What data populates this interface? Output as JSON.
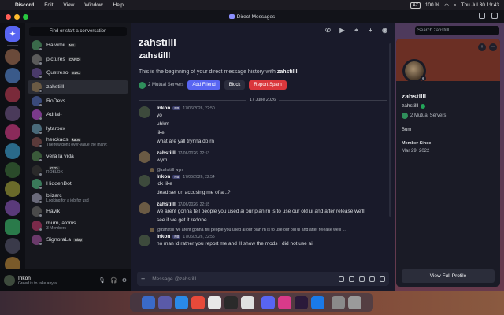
{
  "menubar": {
    "apple": "",
    "app": "Discord",
    "items": [
      "Edit",
      "View",
      "Window",
      "Help"
    ],
    "battery": "100 %",
    "clock": "Thu Jul 30 19:43",
    "input_source": "AZ"
  },
  "window": {
    "title": "Direct Messages"
  },
  "dm_list": {
    "find": "Find or start a conversation",
    "items": [
      {
        "name": "Halwmii",
        "tag": "NB",
        "sub": "",
        "color": "#3a6a4a"
      },
      {
        "name": "pictures",
        "tag": "CARD",
        "sub": "",
        "color": "#5a5a5a"
      },
      {
        "name": "Qustreso",
        "tag": "SDC",
        "sub": "",
        "color": "#4a3a6a"
      },
      {
        "name": "zahstilll",
        "tag": "",
        "sub": "",
        "color": "#6a5a44"
      },
      {
        "name": "RoDevs",
        "tag": "",
        "sub": "",
        "color": "#3a4a7a"
      },
      {
        "name": "Adrial-",
        "tag": "",
        "sub": "",
        "color": "#7a3a8a"
      },
      {
        "name": "lytarbox",
        "tag": "",
        "sub": "",
        "color": "#4a6a7a"
      },
      {
        "name": "herckaos",
        "tag": "kaos",
        "sub": "The few don't over-value the many.",
        "color": "#5a3a3a"
      },
      {
        "name": "vera la vida",
        "tag": "",
        "sub": "",
        "color": "#3a5a3a"
      },
      {
        "name": "",
        "tag": "GTD",
        "sub": "ROBLOX",
        "color": "#2a2a2a"
      },
      {
        "name": "HiddenBot",
        "tag": "",
        "sub": "",
        "color": "#3a7a5a"
      },
      {
        "name": "blizarc",
        "tag": "",
        "sub": "Looking for a job for usd",
        "color": "#6a6a7a"
      },
      {
        "name": "Havik",
        "tag": "",
        "sub": "",
        "color": "#4a4a4a"
      },
      {
        "name": "murn, atonis",
        "tag": "",
        "sub": "3 Members",
        "color": "#7a2a4a"
      },
      {
        "name": "SignoraLa",
        "tag": "Blap",
        "sub": "",
        "color": "#6a3a6a"
      }
    ]
  },
  "user_panel": {
    "name": "Inkon",
    "status": "Greed is to take any a..."
  },
  "chat": {
    "header_name": "zahstilll",
    "search_placeholder": "Search zahstilll",
    "intro_name": "zahstilll",
    "intro_name2": "zahstilll",
    "intro_prefix": "This is the beginning of your direct message history with ",
    "intro_user": "zahstilll",
    "intro_suffix": ".",
    "mutual_servers": "2 Mutual Servers",
    "add_friend": "Add Friend",
    "block": "Block",
    "report_spam": "Report Spam",
    "date_divider": "17 June 2026",
    "composer_placeholder": "Message @zahstilll",
    "messages": [
      {
        "author": "Inkon",
        "badge": "PB",
        "time": "17/06/2026, 22:50",
        "reply": "",
        "lines": [
          "yo",
          "uhkm",
          "like",
          "what are yall trynna do rn"
        ],
        "color": "#3d4a3c"
      },
      {
        "author": "zahstilll",
        "badge": "",
        "time": "17/06/2026, 22:53",
        "reply": "",
        "lines": [
          "wym"
        ],
        "color": "#6a5a44"
      },
      {
        "author": "Inkon",
        "badge": "PB",
        "time": "17/06/2026, 22:54",
        "reply": "@zahstilll wym",
        "lines": [
          "idk like",
          "dead set on accusing me of ai..?"
        ],
        "color": "#3d4a3c"
      },
      {
        "author": "zahstilll",
        "badge": "",
        "time": "17/06/2026, 22:55",
        "reply": "",
        "lines": [
          "we arent gonna tell people you used ai our plan rn is to use our old ui and after release we'll",
          "see if we get it redone"
        ],
        "color": "#6a5a44"
      },
      {
        "author": "Inkon",
        "badge": "PB",
        "time": "17/06/2026, 22:55",
        "reply": "@zahstilll we arent gonna tell people you used ai our plan rn is to use our old ui and after release we'll ...",
        "lines": [
          "no man ld rather you report me and ill show the mods I did not use ai"
        ],
        "color": "#3d4a3c"
      }
    ]
  },
  "profile": {
    "name": "zahstilll",
    "username": "zahstilll",
    "mutual": "2 Mutual Servers",
    "bio": "Bum",
    "member_since_label": "Member Since",
    "member_since": "Mar 29, 2022",
    "full_profile": "View Full Profile"
  },
  "colors": {
    "blurple": "#5865f2",
    "danger": "#da373c",
    "online": "#23a559"
  }
}
